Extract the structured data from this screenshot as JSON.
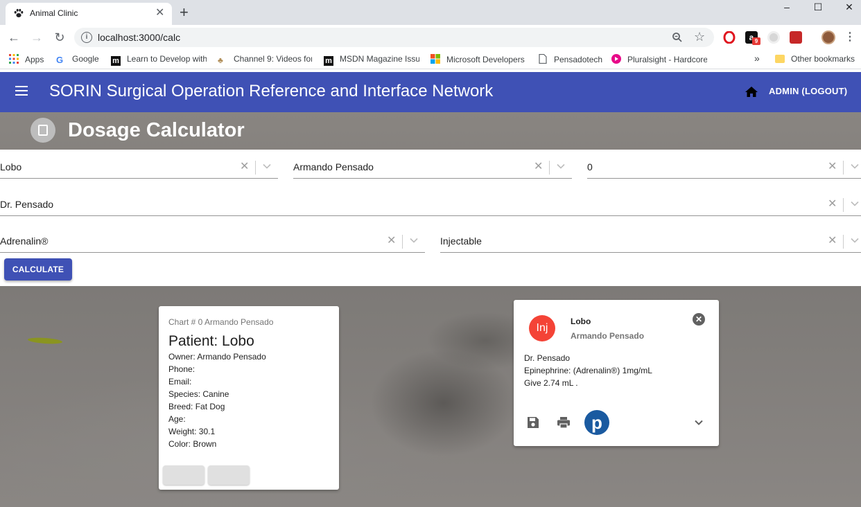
{
  "browser": {
    "tab_title": "Animal Clinic",
    "url": "localhost:3000/calc",
    "bookmarks": [
      {
        "label": "Apps"
      },
      {
        "label": "Google"
      },
      {
        "label": "Learn to Develop with"
      },
      {
        "label": "Channel 9: Videos for"
      },
      {
        "label": "MSDN Magazine Issu"
      },
      {
        "label": "Microsoft Developers"
      },
      {
        "label": "Pensadotech"
      },
      {
        "label": "Pluralsight - Hardcore"
      }
    ],
    "other_bookmarks": "Other bookmarks",
    "overflow_label": "»",
    "extension_badge": "9"
  },
  "appbar": {
    "title": "SORIN Surgical Operation Reference and Interface Network",
    "admin_label": "ADMIN (LOGOUT)"
  },
  "page": {
    "title": "Dosage Calculator"
  },
  "form": {
    "patient": "Lobo",
    "owner": "Armando Pensado",
    "chart_number": "0",
    "doctor": "Dr. Pensado",
    "medication": "Adrenalin®",
    "route": "Injectable",
    "calculate_label": "CALCULATE"
  },
  "patient_card": {
    "chart_line": "Chart # 0 Armando Pensado",
    "name_line": "Patient: Lobo",
    "owner_line": "Owner: Armando Pensado",
    "phone_line": "Phone:",
    "email_line": "Email:",
    "species_line": "Species: Canine",
    "breed_line": "Breed: Fat Dog",
    "age_line": "Age:",
    "weight_line": "Weight: 30.1",
    "color_line": "Color: Brown"
  },
  "dose_card": {
    "avatar": "Inj",
    "title": "Lobo",
    "subtitle": "Armando Pensado",
    "doctor_line": "Dr. Pensado",
    "drug_line": "Epinephrine: (Adrenalin®) 1mg/mL",
    "dose_line": "Give 2.74 mL .",
    "brand_letter": "p"
  },
  "colors": {
    "primary": "#3f51b5",
    "avatar": "#f44336",
    "brand": "#1a5aa0"
  }
}
